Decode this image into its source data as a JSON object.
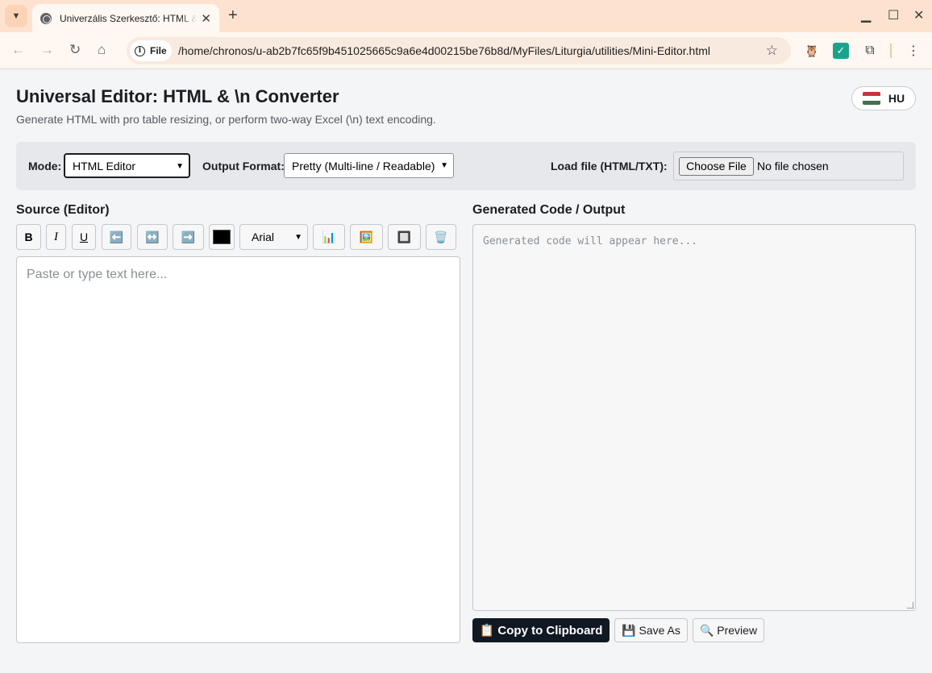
{
  "browser": {
    "tab_title": "Univerzális Szerkesztő: HTML & \\n",
    "site_chip": "File",
    "url": "/home/chronos/u-ab2b7fc65f9b451025665c9a6e4d00215be76b8d/MyFiles/Liturgia/utilities/Mini-Editor.html"
  },
  "header": {
    "title": "Universal Editor: HTML & \\n Converter",
    "subtitle": "Generate HTML with pro table resizing, or perform two-way Excel (\\n) text encoding.",
    "lang_label": "HU"
  },
  "controls": {
    "mode_label": "Mode:",
    "mode_value": "HTML Editor",
    "format_label": "Output Format:",
    "format_value": "Pretty (Multi-line / Readable)",
    "load_label": "Load file (HTML/TXT):",
    "file_button": "Choose File",
    "file_status": "No file chosen"
  },
  "source": {
    "title": "Source (Editor)",
    "placeholder": "Paste or type text here...",
    "toolbar": {
      "bold": "B",
      "italic": "I",
      "underline": "U",
      "align_left": "⬅️",
      "align_center": "↔️",
      "align_right": "➡️",
      "font": "Arial",
      "table": "📊",
      "image": "🖼️",
      "frame": "🔲",
      "clear": "🗑️"
    }
  },
  "output": {
    "title": "Generated Code / Output",
    "placeholder": "Generated code will appear here...",
    "copy_label": "📋 Copy to Clipboard",
    "save_label": "💾 Save As",
    "preview_label": "🔍 Preview"
  },
  "colors": {
    "tabbar": "#fde3cf",
    "primary_button": "#101823",
    "flag_red": "#c8343b",
    "flag_white": "#ffffff",
    "flag_green": "#436f4d"
  }
}
